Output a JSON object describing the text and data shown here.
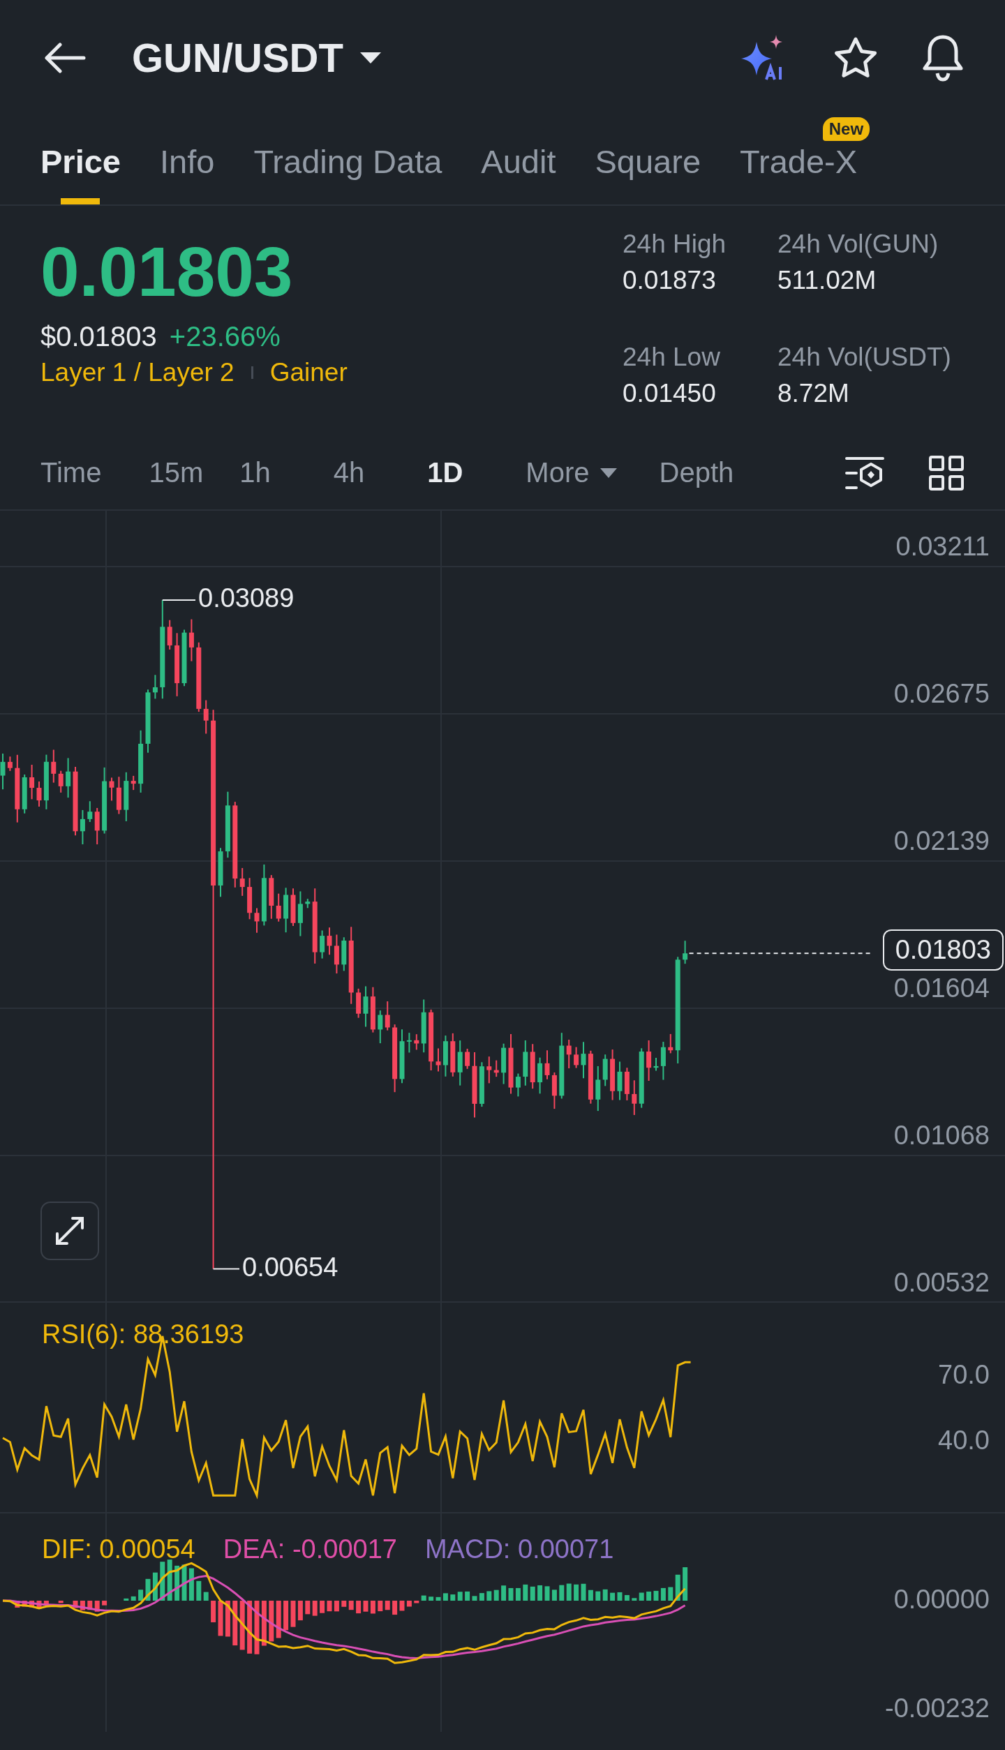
{
  "header": {
    "title": "GUN/USDT"
  },
  "tabs": [
    {
      "label": "Price",
      "selected": true
    },
    {
      "label": "Info",
      "selected": false
    },
    {
      "label": "Trading Data",
      "selected": false
    },
    {
      "label": "Audit",
      "selected": false
    },
    {
      "label": "Square",
      "selected": false
    },
    {
      "label": "Trade-X",
      "selected": false,
      "badge": "New"
    }
  ],
  "price": {
    "last": "0.01803",
    "usd": "$0.01803",
    "change": "+23.66%",
    "tags": [
      "Layer 1 / Layer 2",
      "Gainer"
    ]
  },
  "stats": [
    {
      "label": "24h High",
      "value": "0.01873"
    },
    {
      "label": "24h Vol(GUN)",
      "value": "511.02M"
    },
    {
      "label": "24h Low",
      "value": "0.01450"
    },
    {
      "label": "24h Vol(USDT)",
      "value": "8.72M"
    }
  ],
  "intervals": [
    {
      "label": "Time",
      "selected": false,
      "kind": "plain"
    },
    {
      "label": "15m",
      "selected": false,
      "kind": "plain"
    },
    {
      "label": "1h",
      "selected": false,
      "kind": "plain"
    },
    {
      "label": "4h",
      "selected": false,
      "kind": "plain"
    },
    {
      "label": "1D",
      "selected": true,
      "kind": "plain"
    },
    {
      "label": "More",
      "selected": false,
      "kind": "dropdown"
    },
    {
      "label": "Depth",
      "selected": false,
      "kind": "plain"
    }
  ],
  "chart": {
    "price_axis": [
      "0.03211",
      "0.02675",
      "0.02139",
      "0.01604",
      "0.01068",
      "0.00532"
    ],
    "last_price": "0.01803",
    "high_marker": "0.03089",
    "low_marker": "0.00654"
  },
  "rsi": {
    "label": "RSI(6): 88.36193",
    "axis": [
      "70.0",
      "40.0"
    ]
  },
  "macd": {
    "dif": "DIF: 0.00054",
    "dea": "DEA: -0.00017",
    "macd": "MACD: 0.00071",
    "axis": [
      "0.00000",
      "-0.00232"
    ]
  }
}
